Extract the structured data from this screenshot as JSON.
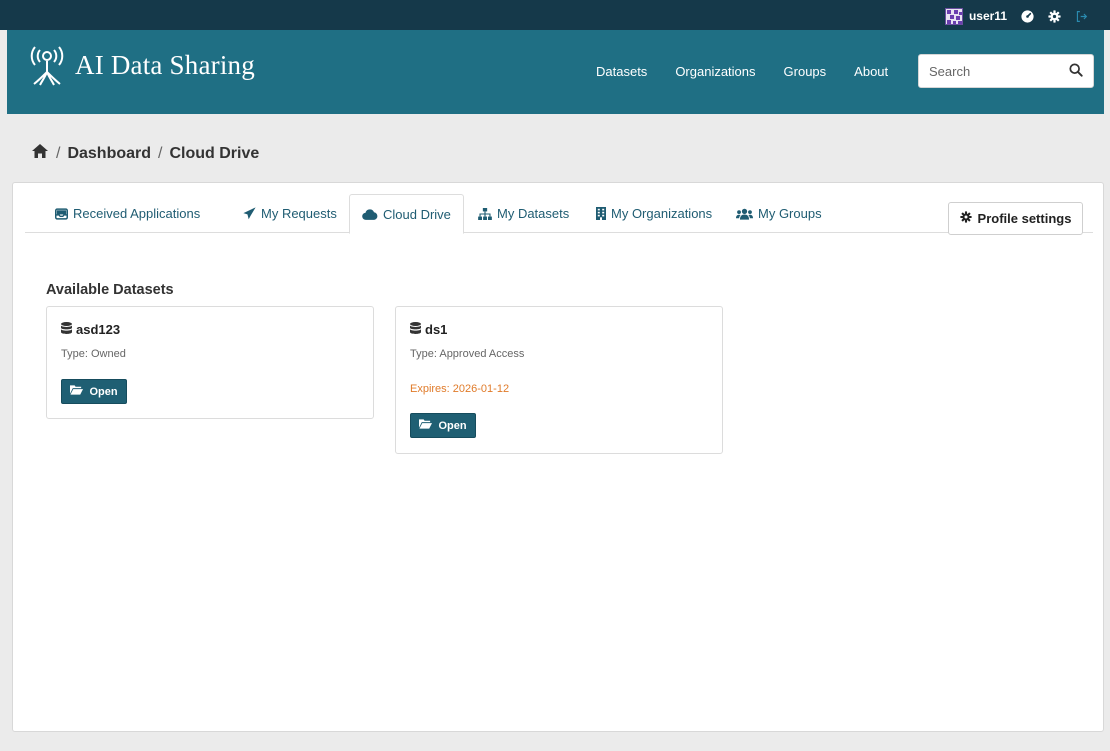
{
  "account": {
    "username": "user11",
    "icons": [
      "dashboard-icon",
      "settings-icon",
      "logout-icon"
    ]
  },
  "brand": {
    "name": "AI Data Sharing"
  },
  "nav": {
    "items": [
      {
        "label": "Datasets"
      },
      {
        "label": "Organizations"
      },
      {
        "label": "Groups"
      },
      {
        "label": "About"
      }
    ]
  },
  "search": {
    "placeholder": "Search"
  },
  "breadcrumb": {
    "separator": "/",
    "items": [
      {
        "label": "Dashboard"
      },
      {
        "label": "Cloud Drive"
      }
    ]
  },
  "tabs": [
    {
      "label": "Received Applications",
      "icon": "inbox-icon",
      "active": false
    },
    {
      "label": "My Requests",
      "icon": "send-icon",
      "active": false
    },
    {
      "label": "Cloud Drive",
      "icon": "cloud-icon",
      "active": true
    },
    {
      "label": "My Datasets",
      "icon": "sitemap-icon",
      "active": false
    },
    {
      "label": "My Organizations",
      "icon": "building-icon",
      "active": false
    },
    {
      "label": "My Groups",
      "icon": "users-icon",
      "active": false
    }
  ],
  "profile_settings": {
    "label": "Profile settings"
  },
  "section": {
    "title": "Available Datasets"
  },
  "datasets": [
    {
      "name": "asd123",
      "type": "Type: Owned",
      "expires": "",
      "open_label": "Open"
    },
    {
      "name": "ds1",
      "type": "Type: Approved Access",
      "expires": "Expires: 2026-01-12",
      "open_label": "Open"
    }
  ],
  "colors": {
    "account_bar": "#15394a",
    "masthead": "#1f6f84",
    "primary_button": "#1f5f73",
    "link": "#1f5c72",
    "expires": "#e07b2a"
  }
}
